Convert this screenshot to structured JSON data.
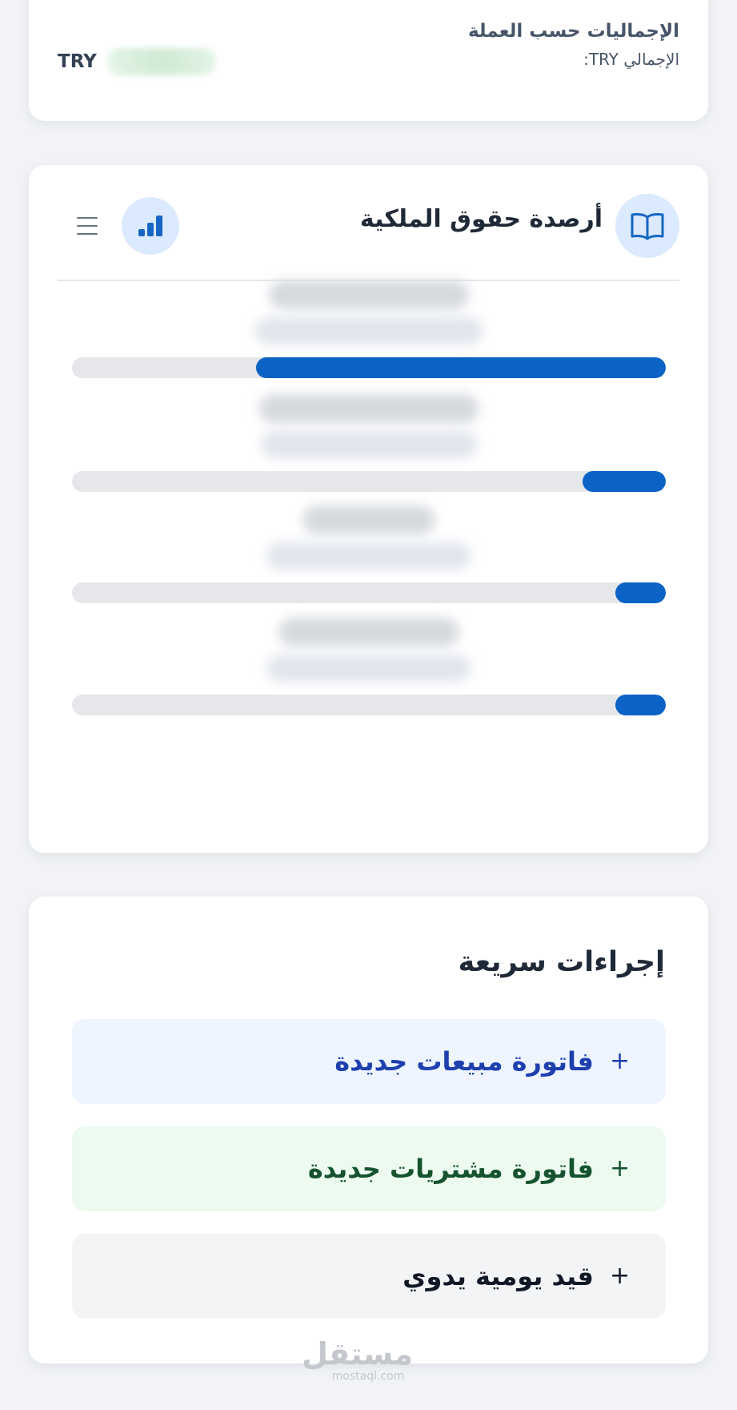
{
  "colors": {
    "primary": "#0b63c5",
    "icon_bg": "#dbeafe",
    "track": "#e5e7eb",
    "sales_bg": "#eef5fe",
    "sales_text": "#1e40af",
    "purchase_bg": "#ecfaef",
    "purchase_text": "#14532d",
    "journal_bg": "#f3f4f6"
  },
  "totals": {
    "heading": "الإجماليات حسب العملة",
    "total_label": "الإجمالي TRY:",
    "currency": "TRY"
  },
  "equity": {
    "title": "أرصدة حقوق الملكية",
    "title_icon": "book-open-icon",
    "chart_button_icon": "bar-chart-icon",
    "menu_icon": "menu-icon",
    "rows": [
      {
        "fill_fraction": 0.69
      },
      {
        "fill_fraction": 0.14
      },
      {
        "fill_fraction": 0.085
      },
      {
        "fill_fraction": 0.085
      }
    ]
  },
  "quick_actions": {
    "title": "إجراءات سريعة",
    "items": [
      {
        "label": "فاتورة مبيعات جديدة",
        "icon": "plus-icon"
      },
      {
        "label": "فاتورة مشتريات جديدة",
        "icon": "plus-icon"
      },
      {
        "label": "قيد يومية يدوي",
        "icon": "plus-icon"
      }
    ]
  },
  "watermark": {
    "arabic": "مستقل",
    "latin": "mostaql.com"
  }
}
